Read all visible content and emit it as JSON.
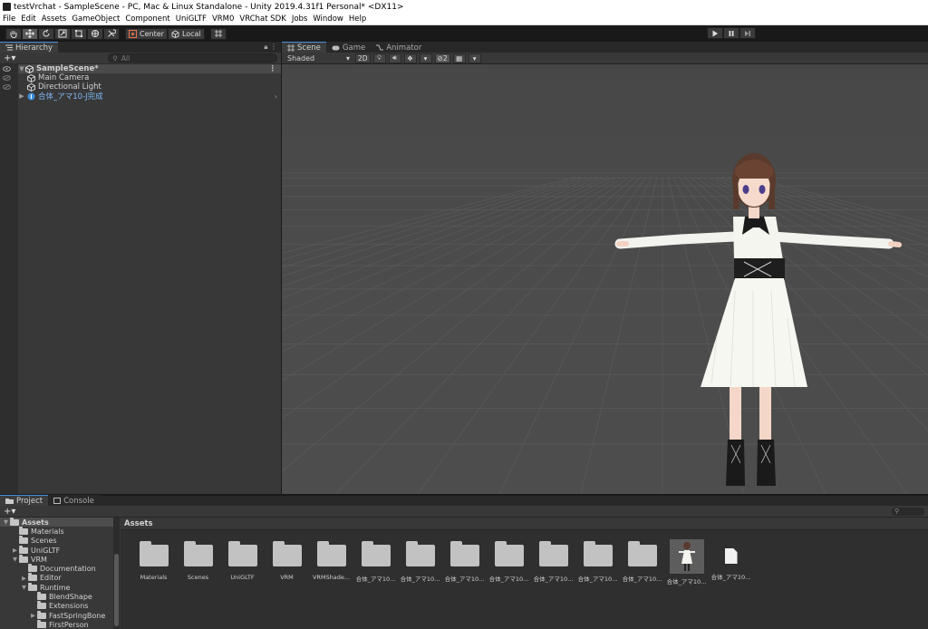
{
  "window": {
    "title": "testVrchat - SampleScene - PC, Mac & Linux Standalone - Unity 2019.4.31f1 Personal* <DX11>"
  },
  "menu": [
    "File",
    "Edit",
    "Assets",
    "GameObject",
    "Component",
    "UniGLTF",
    "VRM0",
    "VRChat SDK",
    "Jobs",
    "Window",
    "Help"
  ],
  "toolbar": {
    "pivot_label": "Center",
    "space_label": "Local"
  },
  "hierarchy": {
    "tab_label": "Hierarchy",
    "search_placeholder": "All",
    "scene_name": "SampleScene*",
    "items": [
      "Main Camera",
      "Directional Light",
      "合体_アマ10-J完成"
    ]
  },
  "scene": {
    "tabs": [
      "Scene",
      "Game",
      "Animator"
    ],
    "shading_mode": "Shaded",
    "mode_2d": "2D",
    "hidden_count": "2"
  },
  "project": {
    "tabs": [
      "Project",
      "Console"
    ],
    "tree": [
      {
        "label": "Assets",
        "depth": 0,
        "arrow": "▼",
        "selected": true
      },
      {
        "label": "Materials",
        "depth": 1,
        "arrow": ""
      },
      {
        "label": "Scenes",
        "depth": 1,
        "arrow": ""
      },
      {
        "label": "UniGLTF",
        "depth": 1,
        "arrow": "▶"
      },
      {
        "label": "VRM",
        "depth": 1,
        "arrow": "▼"
      },
      {
        "label": "Documentation",
        "depth": 2,
        "arrow": ""
      },
      {
        "label": "Editor",
        "depth": 2,
        "arrow": "▶"
      },
      {
        "label": "Runtime",
        "depth": 2,
        "arrow": "▼"
      },
      {
        "label": "BlendShape",
        "depth": 3,
        "arrow": ""
      },
      {
        "label": "Extensions",
        "depth": 3,
        "arrow": ""
      },
      {
        "label": "FastSpringBone",
        "depth": 3,
        "arrow": "▶"
      },
      {
        "label": "FirstPerson",
        "depth": 3,
        "arrow": ""
      }
    ],
    "breadcrumb": "Assets",
    "grid": [
      {
        "label": "Materials",
        "kind": "folder"
      },
      {
        "label": "Scenes",
        "kind": "folder"
      },
      {
        "label": "UniGLTF",
        "kind": "folder"
      },
      {
        "label": "VRM",
        "kind": "folder"
      },
      {
        "label": "VRMShade...",
        "kind": "folder"
      },
      {
        "label": "合体_アマ10...",
        "kind": "folder"
      },
      {
        "label": "合体_アマ10...",
        "kind": "folder"
      },
      {
        "label": "合体_アマ10...",
        "kind": "folder"
      },
      {
        "label": "合体_アマ10...",
        "kind": "folder"
      },
      {
        "label": "合体_アマ10...",
        "kind": "folder"
      },
      {
        "label": "合体_アマ10...",
        "kind": "folder"
      },
      {
        "label": "合体_アマ10...",
        "kind": "folder"
      },
      {
        "label": "合体_アマ10...",
        "kind": "prefab"
      },
      {
        "label": "合体_アマ10...",
        "kind": "file"
      }
    ]
  }
}
